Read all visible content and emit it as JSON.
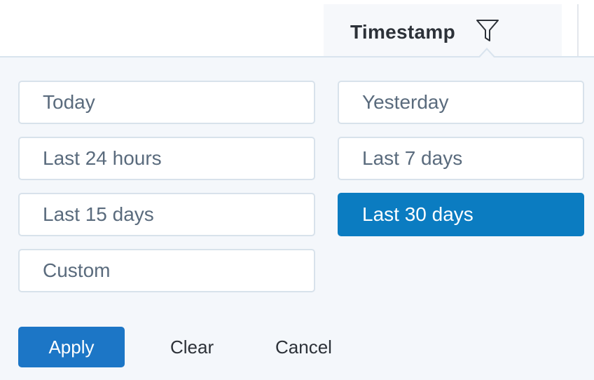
{
  "column": {
    "title": "Timestamp",
    "filter_icon": "filter-funnel-icon"
  },
  "options": [
    {
      "label": "Today",
      "selected": false
    },
    {
      "label": "Yesterday",
      "selected": false
    },
    {
      "label": "Last 24 hours",
      "selected": false
    },
    {
      "label": "Last 7 days",
      "selected": false
    },
    {
      "label": "Last 15 days",
      "selected": false
    },
    {
      "label": "Last 30 days",
      "selected": true
    },
    {
      "label": "Custom",
      "selected": false
    }
  ],
  "actions": {
    "apply_label": "Apply",
    "clear_label": "Clear",
    "cancel_label": "Cancel"
  },
  "colors": {
    "selected_bg": "#0b7cc1",
    "apply_bg": "#1c76c6",
    "popup_bg": "#f4f7fb"
  }
}
